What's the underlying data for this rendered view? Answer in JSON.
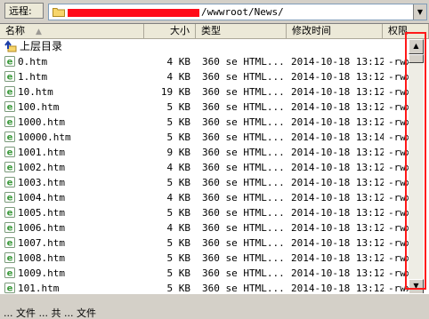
{
  "pathbar": {
    "label": "远程:",
    "path_suffix": "/wwwroot/News/"
  },
  "columns": {
    "name": "名称",
    "size": "大小",
    "type": "类型",
    "modified": "修改时间",
    "perm": "权限"
  },
  "parent_dir_label": "上层目录",
  "files": [
    {
      "name": "0.htm",
      "size": "4 KB",
      "type": "360 se HTML...",
      "date": "2014-10-18 13:12",
      "perm": "-rwx"
    },
    {
      "name": "1.htm",
      "size": "4 KB",
      "type": "360 se HTML...",
      "date": "2014-10-18 13:12",
      "perm": "-rwx"
    },
    {
      "name": "10.htm",
      "size": "19 KB",
      "type": "360 se HTML...",
      "date": "2014-10-18 13:12",
      "perm": "-rwx"
    },
    {
      "name": "100.htm",
      "size": "5 KB",
      "type": "360 se HTML...",
      "date": "2014-10-18 13:12",
      "perm": "-rwx"
    },
    {
      "name": "1000.htm",
      "size": "5 KB",
      "type": "360 se HTML...",
      "date": "2014-10-18 13:12",
      "perm": "-rwx"
    },
    {
      "name": "10000.htm",
      "size": "5 KB",
      "type": "360 se HTML...",
      "date": "2014-10-18 13:14",
      "perm": "-rwx"
    },
    {
      "name": "1001.htm",
      "size": "9 KB",
      "type": "360 se HTML...",
      "date": "2014-10-18 13:12",
      "perm": "-rwx"
    },
    {
      "name": "1002.htm",
      "size": "4 KB",
      "type": "360 se HTML...",
      "date": "2014-10-18 13:12",
      "perm": "-rwx"
    },
    {
      "name": "1003.htm",
      "size": "5 KB",
      "type": "360 se HTML...",
      "date": "2014-10-18 13:12",
      "perm": "-rwx"
    },
    {
      "name": "1004.htm",
      "size": "4 KB",
      "type": "360 se HTML...",
      "date": "2014-10-18 13:12",
      "perm": "-rwx"
    },
    {
      "name": "1005.htm",
      "size": "5 KB",
      "type": "360 se HTML...",
      "date": "2014-10-18 13:12",
      "perm": "-rwx"
    },
    {
      "name": "1006.htm",
      "size": "4 KB",
      "type": "360 se HTML...",
      "date": "2014-10-18 13:12",
      "perm": "-rwx"
    },
    {
      "name": "1007.htm",
      "size": "5 KB",
      "type": "360 se HTML...",
      "date": "2014-10-18 13:12",
      "perm": "-rwx"
    },
    {
      "name": "1008.htm",
      "size": "5 KB",
      "type": "360 se HTML...",
      "date": "2014-10-18 13:12",
      "perm": "-rwx"
    },
    {
      "name": "1009.htm",
      "size": "5 KB",
      "type": "360 se HTML...",
      "date": "2014-10-18 13:12",
      "perm": "-rwx"
    },
    {
      "name": "101.htm",
      "size": "5 KB",
      "type": "360 se HTML...",
      "date": "2014-10-18 13:12",
      "perm": "-rwx"
    }
  ],
  "statusbar": {
    "text": "... 文件 ... 共 ... 文件"
  },
  "colors": {
    "highlight": "#ff1a1a",
    "redaction": "#ff0a1a",
    "file_icon": "#3a9a3a"
  }
}
